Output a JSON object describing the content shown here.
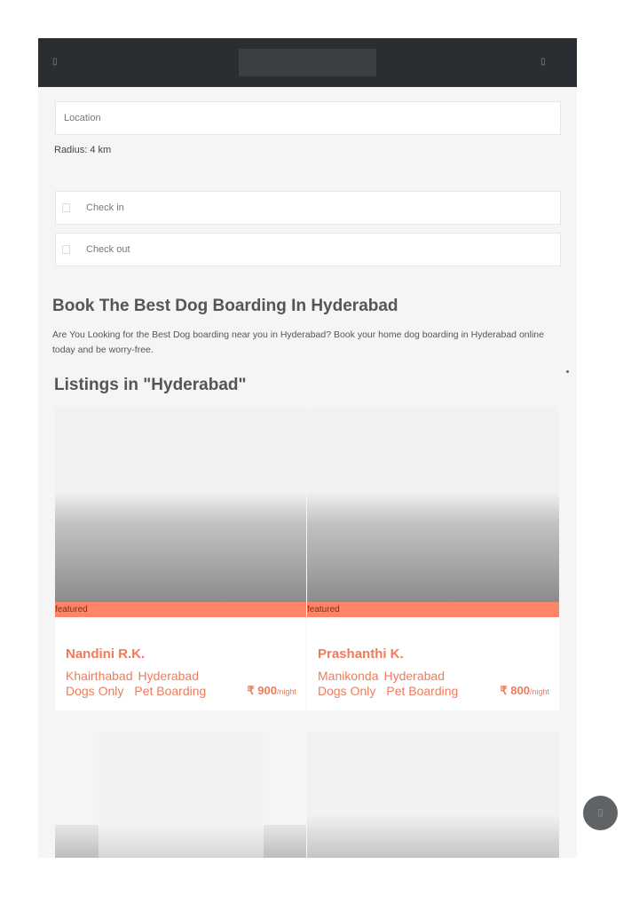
{
  "header": {
    "menu_icon": "menu-icon",
    "user_icon": "user-icon"
  },
  "search": {
    "location_placeholder": "Location",
    "radius_label": "Radius: 4 km",
    "check_in_placeholder": "Check in",
    "check_out_placeholder": "Check out",
    "calendar_icon": "calendar-icon"
  },
  "main": {
    "heading": "Book The Best Dog Boarding In Hyderabad",
    "description": "Are You Looking for the Best Dog boarding near you in Hyderabad? Book your home dog boarding in Hyderabad online today and be worry-free.",
    "listings_title": "Listings in \"Hyderabad\""
  },
  "listings": [
    {
      "badge": "featured",
      "name": "Nandini R.K.",
      "locality": "Khairthabad",
      "city": "Hyderabad",
      "tag1": "Dogs Only",
      "tag2": "Pet Boarding",
      "price": "₹ 900",
      "price_unit": "/night"
    },
    {
      "badge": "featured",
      "name": "Prashanthi K.",
      "locality": "Manikonda",
      "city": "Hyderabad",
      "tag1": "Dogs Only",
      "tag2": "Pet Boarding",
      "price": "₹ 800",
      "price_unit": "/night"
    }
  ],
  "colors": {
    "header_bg": "#2a2e32",
    "accent": "#f07b5a",
    "featured_bg": "#ff8566",
    "page_bg": "#f5f5f5"
  },
  "fab": {
    "icon": "chat-icon"
  }
}
